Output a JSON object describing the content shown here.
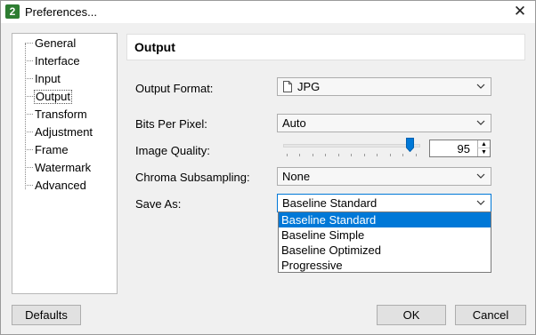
{
  "window": {
    "title": "Preferences...",
    "app_icon_label": "2",
    "close_glyph": "✕"
  },
  "sidebar": {
    "items": [
      {
        "label": "General"
      },
      {
        "label": "Interface"
      },
      {
        "label": "Input"
      },
      {
        "label": "Output",
        "selected": true
      },
      {
        "label": "Transform"
      },
      {
        "label": "Adjustment"
      },
      {
        "label": "Frame"
      },
      {
        "label": "Watermark"
      },
      {
        "label": "Advanced"
      }
    ]
  },
  "panel": {
    "title": "Output",
    "output_format": {
      "label": "Output Format:",
      "value": "JPG",
      "icon": "file-icon"
    },
    "bits_per_pixel": {
      "label": "Bits Per Pixel:",
      "value": "Auto"
    },
    "image_quality": {
      "label": "Image Quality:",
      "value": "95",
      "slider_fraction": 0.95
    },
    "chroma_subsampling": {
      "label": "Chroma Subsampling:",
      "value": "None"
    },
    "save_as": {
      "label": "Save As:",
      "value": "Baseline Standard",
      "options": [
        "Baseline Standard",
        "Baseline Simple",
        "Baseline Optimized",
        "Progressive"
      ],
      "highlighted": "Baseline Standard"
    }
  },
  "buttons": {
    "defaults": "Defaults",
    "ok": "OK",
    "cancel": "Cancel"
  },
  "colors": {
    "accent": "#0078d7",
    "dialog_bg": "#f0f0f0"
  }
}
